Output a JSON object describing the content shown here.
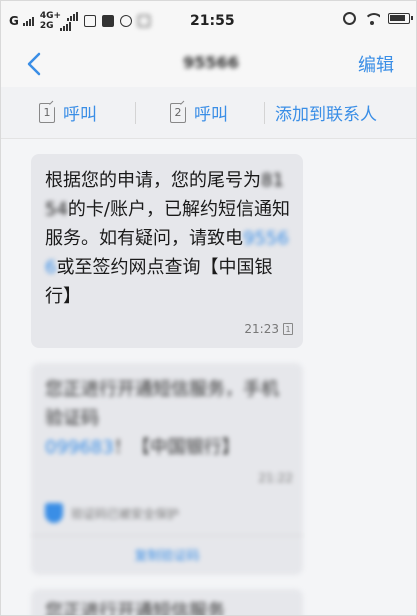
{
  "status_bar": {
    "carrier_g": "G",
    "network_top": "4G+",
    "network_bottom": "2G",
    "time": "21:55"
  },
  "nav": {
    "title": "95566",
    "edit_label": "编辑"
  },
  "actions": {
    "call1_label": "呼叫",
    "call1_sim": "1",
    "call2_label": "呼叫",
    "call2_sim": "2",
    "add_contact_label": "添加到联系人"
  },
  "messages": [
    {
      "text_part1": "根据您的申请，您的尾号为",
      "card_number": "8154",
      "text_part2": "的卡/账户，已解约短信通知服务。如有疑问，请致电",
      "phone": "95566",
      "text_part3": "或至签约网点查询【中国银行】",
      "time": "21:23",
      "sim": "1"
    },
    {
      "text": "您正进行开通短信服务，手机验证码",
      "code": "099683",
      "text_after": "！【中国银行】",
      "time": "21:22",
      "safety_text": "验证码已被安全保护",
      "link_text": "复制验证码"
    },
    {
      "text": "您正进行开通短信服务"
    }
  ]
}
